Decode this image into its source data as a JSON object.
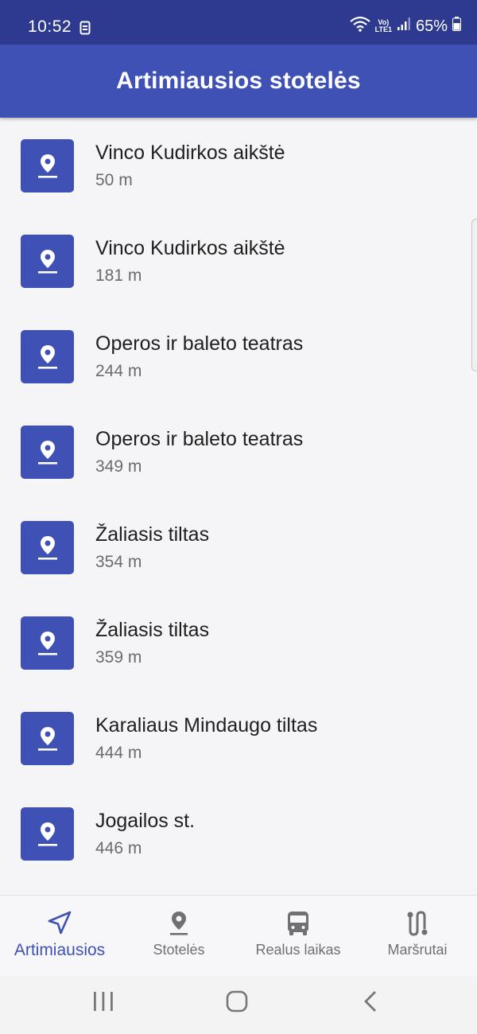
{
  "status_bar": {
    "time": "10:52",
    "battery": "65%",
    "volte_line1": "Vo)",
    "volte_line2": "LTE1"
  },
  "app_bar": {
    "title": "Artimiausios stotelės"
  },
  "stops": [
    {
      "name": "Vinco Kudirkos aikštė",
      "distance": "50 m"
    },
    {
      "name": "Vinco Kudirkos aikštė",
      "distance": "181 m"
    },
    {
      "name": "Operos ir baleto teatras",
      "distance": "244 m"
    },
    {
      "name": "Operos ir baleto teatras",
      "distance": "349 m"
    },
    {
      "name": "Žaliasis tiltas",
      "distance": "354 m"
    },
    {
      "name": "Žaliasis tiltas",
      "distance": "359 m"
    },
    {
      "name": "Karaliaus Mindaugo tiltas",
      "distance": "444 m"
    },
    {
      "name": "Jogailos st.",
      "distance": "446 m"
    }
  ],
  "bottom_nav": {
    "items": [
      {
        "label": "Artimiausios",
        "icon": "navigation-arrow-icon",
        "active": true
      },
      {
        "label": "Stotelės",
        "icon": "location-pin-icon",
        "active": false
      },
      {
        "label": "Realus laikas",
        "icon": "bus-icon",
        "active": false
      },
      {
        "label": "Maršrutai",
        "icon": "route-icon",
        "active": false
      }
    ]
  },
  "colors": {
    "primary": "#3f51b5",
    "status_bar": "#2e3a8f",
    "inactive": "#707070"
  }
}
